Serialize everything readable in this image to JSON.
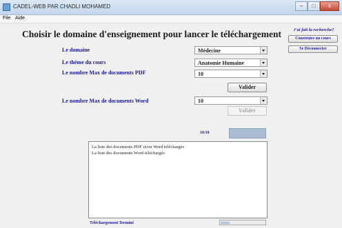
{
  "window": {
    "title": "CADEL-WEB PAR CHADLI MOHAMED",
    "minimize": "–",
    "maximize": "□",
    "close": "x"
  },
  "menu": {
    "file": "File",
    "help": "Aide"
  },
  "heading": "Choisir le domaine d'enseignement pour lancer le téléchargement",
  "form": {
    "domain_label": "Le domaine",
    "domain_value": "Médecine",
    "theme_label": "Le thème du cours",
    "theme_value": "Anatomie Humaine",
    "pdf_label": "Le nombre Max de documents PDF",
    "pdf_value": "10",
    "validate_pdf": "Valider",
    "word_label": "Le nombre Max de documents Word",
    "word_value": "10",
    "validate_word": "Valider"
  },
  "side": {
    "link": "J'ai fait la recherche?",
    "build_button": "Construire un cours",
    "logout_button": "Se Déconnecter"
  },
  "progress_count": "10/10",
  "log": {
    "lines": [
      "La liste des documents PDF et/ou Word téléchargés",
      "La liste des documents Word téléchargés"
    ]
  },
  "status": "Téléchargement Terminé",
  "download_progress": 0.2
}
